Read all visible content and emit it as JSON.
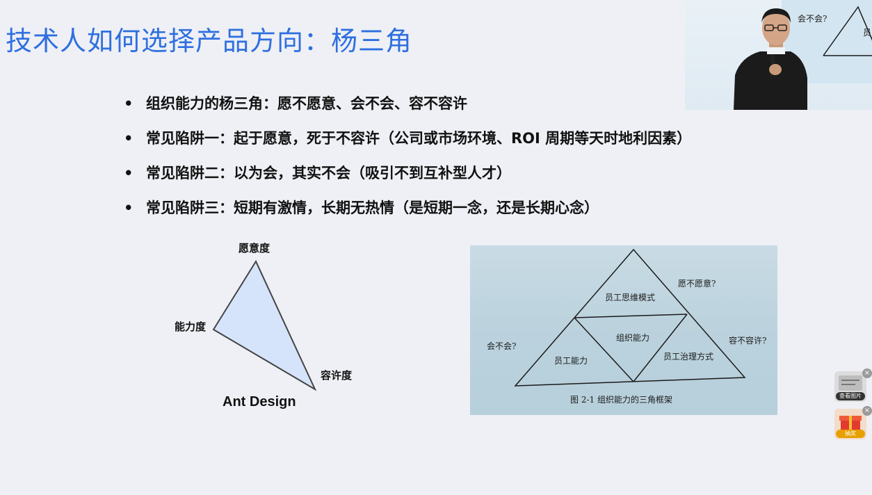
{
  "slide": {
    "title": "技术人如何选择产品方向：杨三角",
    "bullets": [
      "组织能力的杨三角：愿不愿意、会不会、容不容许",
      "常见陷阱一：起于愿意，死于不容许（公司或市场环境、ROI 周期等天时地利因素）",
      "常见陷阱二：以为会，其实不会（吸引不到互补型人才）",
      "常见陷阱三：短期有激情，长期无热情（是短期一念，还是长期心念）"
    ],
    "bullet_char": "•"
  },
  "ant_triangle": {
    "top_label": "愿意度",
    "left_label": "能力度",
    "right_label": "容许度",
    "caption": "Ant Design",
    "fill": "#d6e4fb",
    "stroke": "#444444"
  },
  "book_figure": {
    "top_cell": "员工思维模式",
    "middle_cell": "组织能力",
    "left_cell": "员工能力",
    "right_cell": "员工治理方式",
    "q_willing": "愿不愿意?",
    "q_can": "会不会?",
    "q_allow": "容不容许?",
    "caption": "图 2-1   组织能力的三角框架"
  },
  "video": {
    "q_can": "会不会?",
    "cell": "员"
  },
  "side_widgets": [
    {
      "label": "查看图片",
      "icon": "image-icon",
      "color": "#333333"
    },
    {
      "label": "抽奖",
      "icon": "gift-icon",
      "color": "#e8a000"
    }
  ],
  "close_glyph": "×"
}
